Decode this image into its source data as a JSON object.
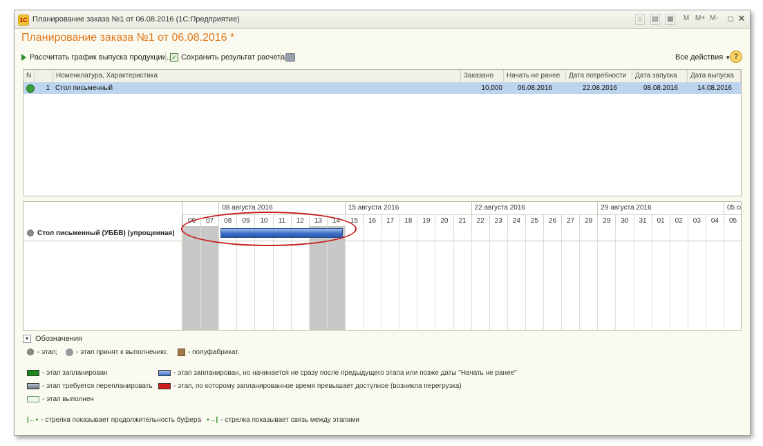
{
  "window": {
    "title": "Планирование заказа №1 от 06.08.2016  (1С:Предприятие)",
    "titlebar_buttons": [
      "M",
      "M+",
      "M-"
    ]
  },
  "document": {
    "title": "Планирование заказа №1 от 06.08.2016 *"
  },
  "toolbar": {
    "calculate_label": "Рассчитать график выпуска продукции...",
    "save_label": "Сохранить результат расчета",
    "all_actions_label": "Все действия",
    "help_label": "?"
  },
  "table": {
    "columns": [
      "N",
      "Номенклатура, Характеристика",
      "Заказано",
      "Начать не ранее",
      "Дата потребности",
      "Дата запуска",
      "Дата выпуска"
    ],
    "rows": [
      {
        "n": "1",
        "item": "Стол письменный",
        "ordered": "10,000",
        "start_not_before": "06.08.2016",
        "need_date": "22.08.2016",
        "launch_date": "08.08.2016",
        "release_date": "14.08.2016"
      }
    ]
  },
  "gantt": {
    "weeks": [
      "08 августа 2016",
      "15 августа 2016",
      "22 августа 2016",
      "29 августа 2016",
      "05 се"
    ],
    "days": [
      "06",
      "07",
      "08",
      "09",
      "10",
      "11",
      "12",
      "13",
      "14",
      "15",
      "16",
      "17",
      "18",
      "19",
      "20",
      "21",
      "22",
      "23",
      "24",
      "25",
      "26",
      "27",
      "28",
      "29",
      "30",
      "31",
      "01",
      "02",
      "03",
      "04",
      "05"
    ],
    "weekend_indices": [
      0,
      1,
      7,
      8
    ],
    "row_label": "Стол письменный (УББВ) (упрощенная)",
    "bar": {
      "start_day": "08",
      "end_day": "14",
      "status": "этап запланирован, но начинается не сразу после предыдущего этапа"
    },
    "bar_start_index": 2,
    "bar_end_index": 8
  },
  "legend": {
    "title": "Обозначения",
    "icons_line": {
      "stage": "- этап;",
      "stage_accepted": "- этап принят к выполнению;",
      "semi_product": "- полуфабрикат."
    },
    "items": {
      "planned": "- этап запланирован",
      "planned_late": "- этап запланирован, но начинается не сразу после предыдущего этапа или позже даты \"Начать не ранее\"",
      "replan": "- этап требуется перепланировать",
      "overload": "- этап, по которому запланированное время превышает доступное (возникла перегрузка)",
      "done": "- этап выполнен"
    },
    "arrows": {
      "buffer": "- стрелка показывает продолжительность буфера",
      "link": "- стрелка показывает связь между этапами"
    }
  },
  "colors": {
    "title_orange": "#e0771a",
    "selected_row": "#bcd4ee",
    "bar_blue": "#3b6fc8",
    "highlight_red": "#c91d1d",
    "weekend_gray": "#c8c8c8"
  }
}
